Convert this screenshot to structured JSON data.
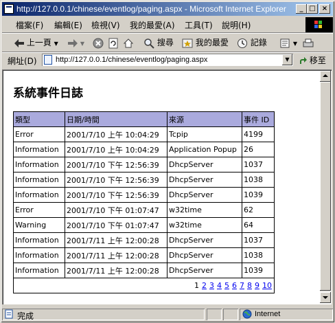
{
  "window": {
    "title": "http://127.0.0.1/chinese/eventlog/paging.aspx - Microsoft Internet Explorer",
    "min_glyph": "_",
    "max_glyph": "□",
    "close_glyph": "×"
  },
  "menu": [
    "檔案(F)",
    "編輯(E)",
    "檢視(V)",
    "我的最愛(A)",
    "工具(T)",
    "說明(H)"
  ],
  "toolbar": {
    "back_label": "上一頁",
    "search_label": "搜尋",
    "favorites_label": "我的最愛",
    "history_label": "記錄"
  },
  "address": {
    "label": "網址(D)",
    "url": "http://127.0.0.1/chinese/eventlog/paging.aspx",
    "go_label": "移至"
  },
  "page": {
    "title": "系統事件日誌",
    "columns": [
      "類型",
      "日期/時間",
      "來源",
      "事件 ID"
    ],
    "rows": [
      [
        "Error",
        "2001/7/10 上午 10:04:29",
        "Tcpip",
        "4199"
      ],
      [
        "Information",
        "2001/7/10 上午 10:04:29",
        "Application Popup",
        "26"
      ],
      [
        "Information",
        "2001/7/10 下午 12:56:39",
        "DhcpServer",
        "1037"
      ],
      [
        "Information",
        "2001/7/10 下午 12:56:39",
        "DhcpServer",
        "1038"
      ],
      [
        "Information",
        "2001/7/10 下午 12:56:39",
        "DhcpServer",
        "1039"
      ],
      [
        "Error",
        "2001/7/10 下午 01:07:47",
        "w32time",
        "62"
      ],
      [
        "Warning",
        "2001/7/10 下午 01:07:47",
        "w32time",
        "64"
      ],
      [
        "Information",
        "2001/7/11 上午 12:00:28",
        "DhcpServer",
        "1037"
      ],
      [
        "Information",
        "2001/7/11 上午 12:00:28",
        "DhcpServer",
        "1038"
      ],
      [
        "Information",
        "2001/7/11 上午 12:00:28",
        "DhcpServer",
        "1039"
      ]
    ],
    "pager": {
      "current": "1",
      "pages": [
        "2",
        "3",
        "4",
        "5",
        "6",
        "7",
        "8",
        "9",
        "10"
      ]
    }
  },
  "status": {
    "text": "完成",
    "zone": "Internet"
  },
  "colors": {
    "header_bg": "#aaaadd",
    "link": "#0000ee",
    "titlebar_start": "#0a246a",
    "titlebar_end": "#a6caf0"
  }
}
